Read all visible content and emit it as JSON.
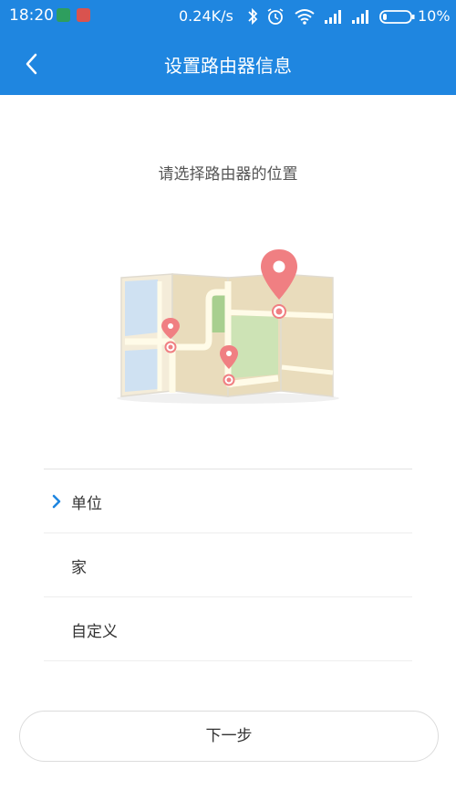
{
  "status_bar": {
    "time": "18:20",
    "network_speed": "0.24K/s",
    "battery": "10%",
    "icons": [
      "shield-app-icon",
      "wifi-app-icon",
      "bluetooth-icon",
      "alarm-icon",
      "wifi-icon",
      "signal-icon",
      "signal-icon",
      "battery-icon"
    ]
  },
  "header": {
    "title": "设置路由器信息",
    "back_icon": "chevron-left-icon"
  },
  "content": {
    "prompt": "请选择路由器的位置",
    "illustration": "map-with-pins"
  },
  "options": [
    {
      "label": "单位",
      "selected": true
    },
    {
      "label": "家",
      "selected": false
    },
    {
      "label": "自定义",
      "selected": false
    }
  ],
  "footer": {
    "next_label": "下一步"
  },
  "colors": {
    "primary": "#1f86e0",
    "pin": "#f07f82"
  }
}
